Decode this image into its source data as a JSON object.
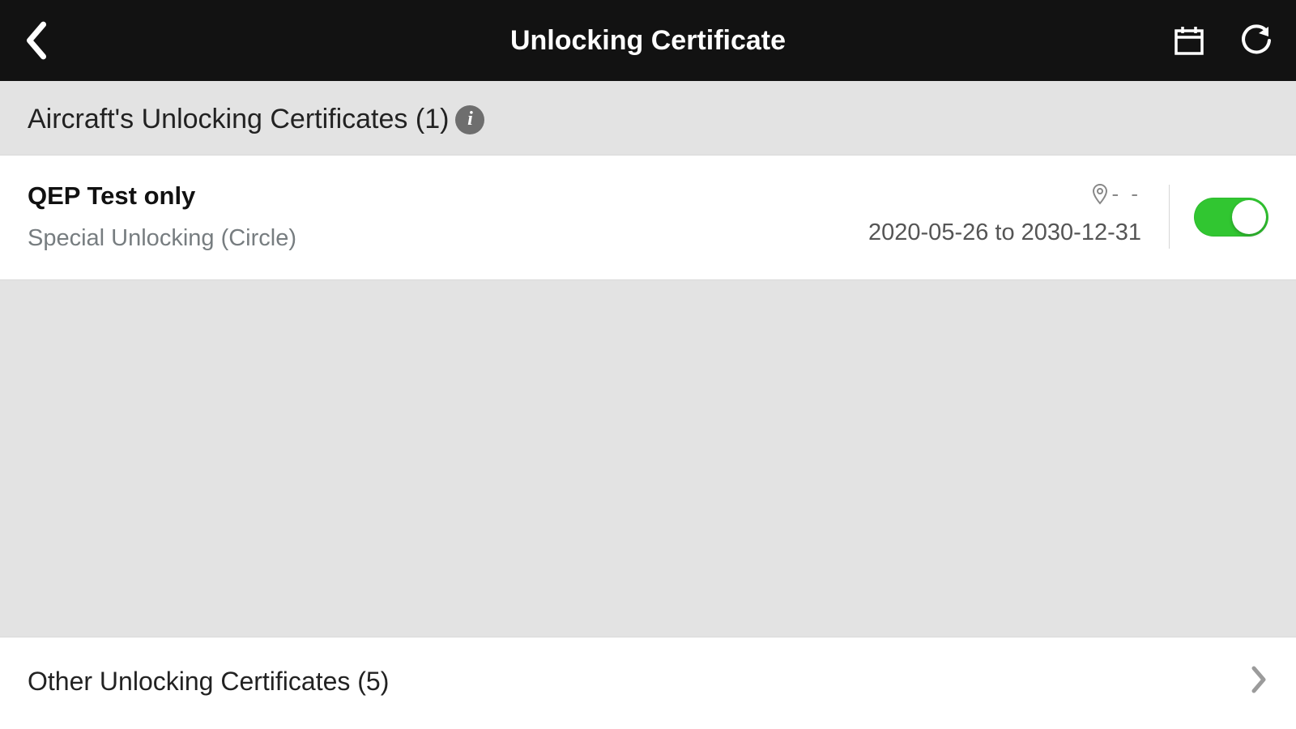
{
  "header": {
    "title": "Unlocking Certificate"
  },
  "section": {
    "title_prefix": "Aircraft's Unlocking Certificates",
    "count": "(1)"
  },
  "certificate": {
    "name": "QEP Test only",
    "type": "Special Unlocking (Circle)",
    "location_text": "- -",
    "date_range": "2020-05-26 to 2030-12-31",
    "enabled": true
  },
  "other": {
    "title_prefix": "Other Unlocking Certificates",
    "count": "(5)"
  }
}
